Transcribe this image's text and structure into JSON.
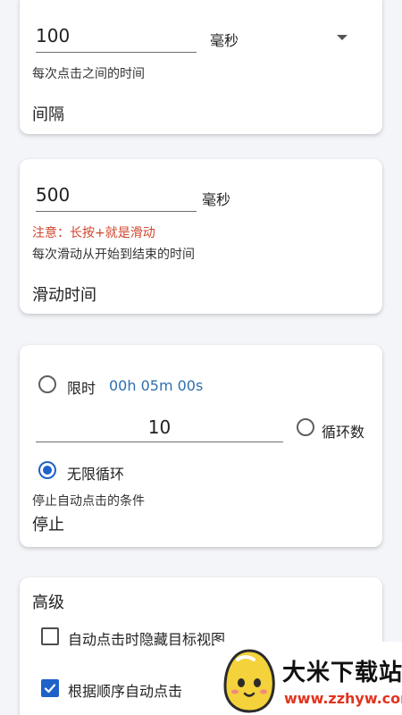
{
  "interval": {
    "value": "100",
    "unit": "毫秒",
    "description": "每次点击之间的时间",
    "title": "间隔"
  },
  "swipe": {
    "value": "500",
    "unit": "毫秒",
    "warning": "注意：长按+就是滑动",
    "description": "每次滑动从开始到结束的时间",
    "title": "滑动时间"
  },
  "stop": {
    "time_limit_label": "限时",
    "time_limit_value": "00h 05m 00s",
    "cycles_value": "10",
    "cycles_label": "循环数",
    "infinite_label": "无限循环",
    "selected": "无限循环",
    "description": "停止自动点击的条件",
    "title": "停止"
  },
  "advanced": {
    "title": "高级",
    "options": [
      {
        "label": "自动点击时隐藏目标视图",
        "checked": false
      },
      {
        "label": "根据顺序自动点击",
        "checked": true
      }
    ]
  },
  "watermark": {
    "title": "大米下载站",
    "url": "www.zzhyw.com"
  },
  "colors": {
    "accent": "#1e62c9",
    "warning": "#d0452b",
    "link_value": "#2e6fb0",
    "background": "#f4f5f9"
  }
}
